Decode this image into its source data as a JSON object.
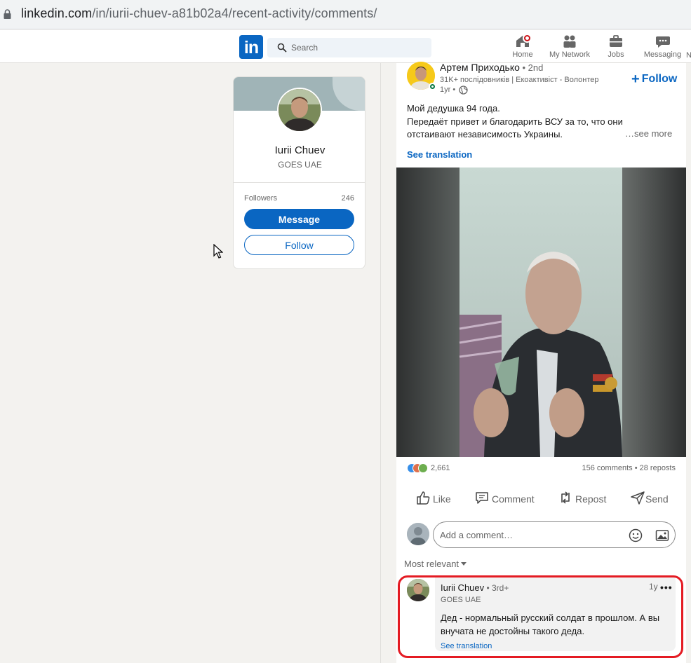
{
  "browser": {
    "url_host": "linkedin.com",
    "url_path": "/in/iurii-chuev-a81b02a4/recent-activity/comments/"
  },
  "header": {
    "search_placeholder": "Search",
    "nav": [
      {
        "label": "Home"
      },
      {
        "label": "My Network"
      },
      {
        "label": "Jobs"
      },
      {
        "label": "Messaging"
      },
      {
        "label": "N"
      }
    ]
  },
  "profile": {
    "name": "Iurii Chuev",
    "headline": "GOES UAE",
    "followers_label": "Followers",
    "followers_count": "246",
    "message_label": "Message",
    "follow_label": "Follow"
  },
  "post": {
    "author": "Артем Приходько",
    "degree": " • 2nd",
    "subtitle": "31K+ послідовників | Екоактивіст - Волонтер",
    "time": "1yr •",
    "follow_label": "Follow",
    "text_lines": [
      "Мой дедушка 94 года.",
      "Передаёт привет и благодарить ВСУ за то, что они",
      "отстаивают независимость Украины."
    ],
    "see_more": "…see more",
    "see_translation": "See translation",
    "reactions_count": "2,661",
    "comments_reposts": "156 comments • 28 reposts",
    "actions": [
      {
        "label": "Like",
        "icon": "like-icon"
      },
      {
        "label": "Comment",
        "icon": "comment-icon"
      },
      {
        "label": "Repost",
        "icon": "repost-icon"
      },
      {
        "label": "Send",
        "icon": "send-icon"
      }
    ],
    "comment_placeholder": "Add a comment…",
    "sort_label": "Most relevant"
  },
  "comment": {
    "author": "Iurii Chuev",
    "degree": " • 3rd+",
    "headline": "GOES UAE",
    "time": "1y",
    "more": "•••",
    "text": "Дед - нормальный русский солдат в прошлом. А вы внучата не достойны такого деда.",
    "see_translation": "See translation"
  },
  "colors": {
    "linkedin_blue": "#0a66c2",
    "highlight_red": "#e41b23",
    "background": "#f3f2ef"
  }
}
